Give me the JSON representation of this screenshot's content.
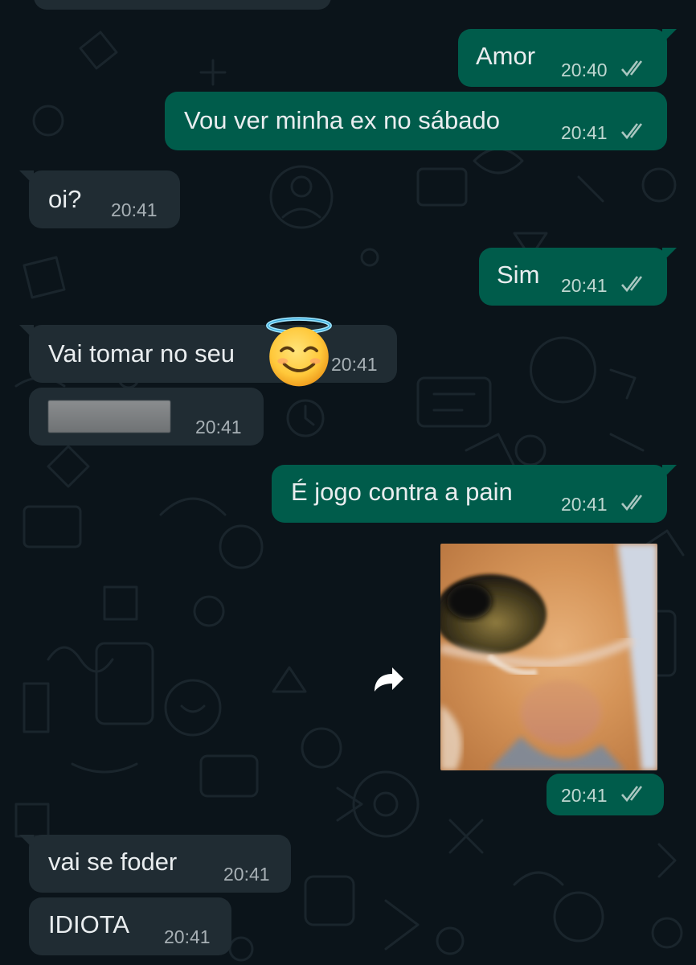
{
  "colors": {
    "background": "#0b141a",
    "incoming_bubble": "#202c33",
    "outgoing_bubble": "#005c4b",
    "read_ticks": "#a9c6c0"
  },
  "messages": [
    {
      "direction": "outgoing",
      "text": "Amor",
      "time": "20:40",
      "status": "read"
    },
    {
      "direction": "outgoing",
      "text": "Vou ver minha ex no sábado",
      "time": "20:41",
      "status": "read"
    },
    {
      "direction": "incoming",
      "text": "oi?",
      "time": "20:41"
    },
    {
      "direction": "outgoing",
      "text": "Sim",
      "time": "20:41",
      "status": "read"
    },
    {
      "direction": "incoming",
      "text": "Vai tomar no seu",
      "time": "20:41",
      "emoji": "smiling-face-with-halo"
    },
    {
      "direction": "incoming",
      "text": "",
      "time": "20:41",
      "redacted": true
    },
    {
      "direction": "outgoing",
      "text": "É jogo contra a pain",
      "time": "20:41",
      "status": "read"
    },
    {
      "direction": "outgoing",
      "type": "image",
      "image": "close-up-orange-cat-face-photo",
      "time": "20:41",
      "status": "read",
      "forward_icon": "forward-arrow-icon"
    },
    {
      "direction": "incoming",
      "text": "vai se foder",
      "time": "20:41"
    },
    {
      "direction": "incoming",
      "text": "IDIOTA",
      "time": "20:41"
    }
  ]
}
